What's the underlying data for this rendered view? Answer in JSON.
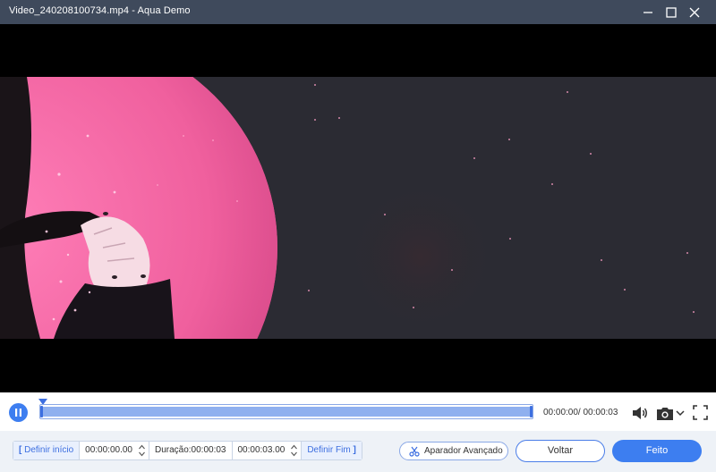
{
  "window": {
    "title": "Video_240208100734.mp4  -  Aqua Demo",
    "controls": [
      "minimize-icon",
      "maximize-icon",
      "close-icon"
    ]
  },
  "player": {
    "state": "playing",
    "pause_icon": "pause-icon",
    "time_current": "00:00:00",
    "time_total": "00:00:03",
    "time_readout": "00:00:00/ 00:00:03",
    "icons": [
      "volume-icon",
      "camera-icon",
      "chevron-down-icon",
      "fullscreen-icon"
    ],
    "accent_color": "#3d7ef0"
  },
  "trim": {
    "set_start_label": "Definir início",
    "start_value": "00:00:00.00",
    "duration_label": "Duração:00:00:03",
    "end_value": "00:00:03.00",
    "set_end_label": "Definir Fim",
    "advanced_label": "Aparador Avançado"
  },
  "actions": {
    "back_label": "Voltar",
    "done_label": "Feito"
  }
}
